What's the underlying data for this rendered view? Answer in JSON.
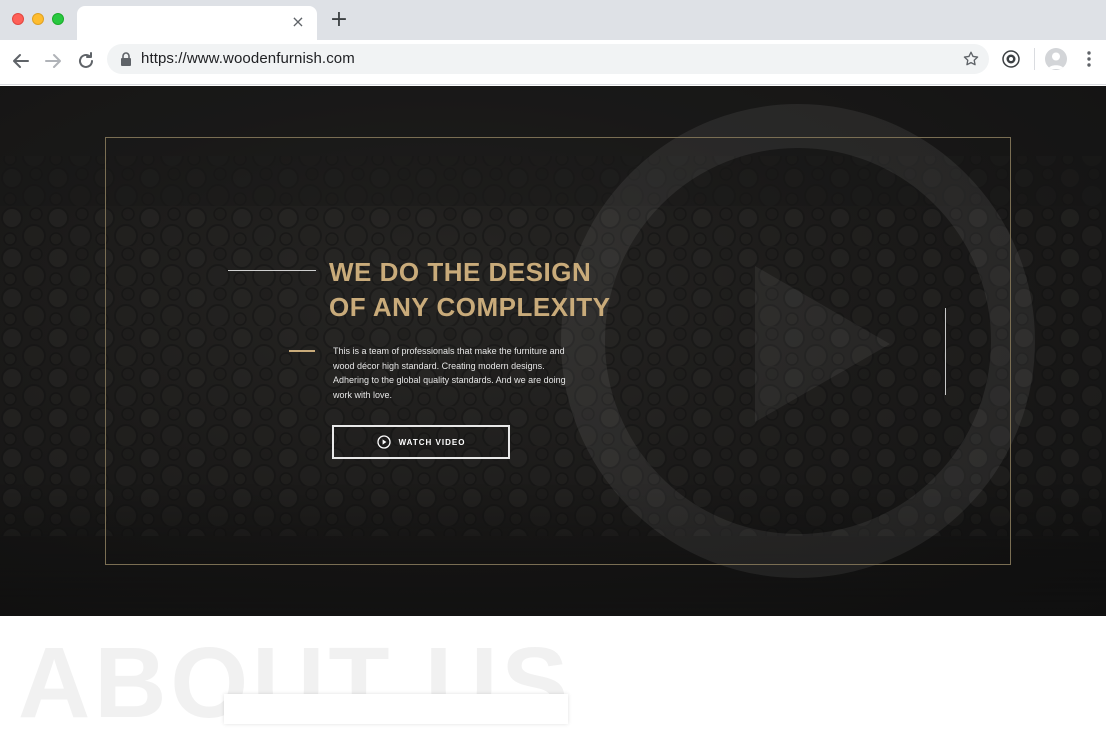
{
  "browser": {
    "url": "https://www.woodenfurnish.com",
    "tab_close_glyph": "×",
    "new_tab_glyph": "+"
  },
  "icons": {
    "back": "arrow-left-icon",
    "forward": "arrow-right-icon",
    "reload": "reload-icon",
    "lock": "lock-icon",
    "star": "star-icon",
    "extension": "extension-icon",
    "profile": "profile-icon",
    "menu": "menu-icon",
    "play": "play-icon"
  },
  "hero": {
    "headline_line1": "WE DO THE DESIGN",
    "headline_line2": "OF ANY COMPLEXITY",
    "description": "This is a team of professionals that make the furniture and wood décor high standard. Creating modern designs. Adhering to the global quality standards. And we are doing work with love.",
    "watch_button": "WATCH VIDEO"
  },
  "about": {
    "background_title": "ABOUT US"
  },
  "colors": {
    "accent_gold": "#c9ab7a",
    "frame_gold": "#7a6e53",
    "hero_bg": "#1b1a19"
  }
}
